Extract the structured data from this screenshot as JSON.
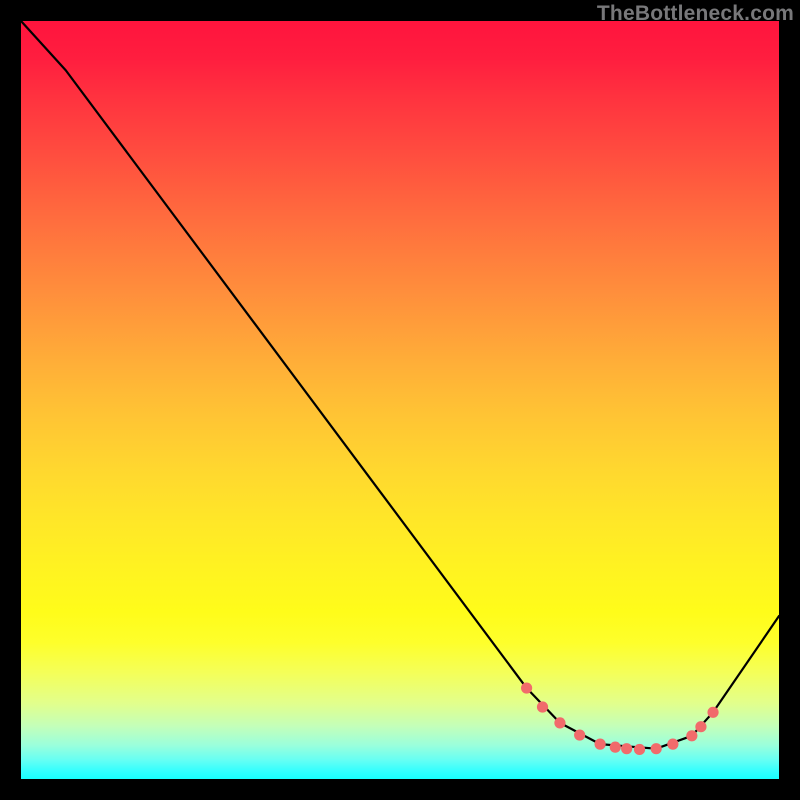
{
  "watermark": "TheBottleneck.com",
  "chart_data": {
    "type": "line",
    "title": "",
    "xlabel": "",
    "ylabel": "",
    "xlim": [
      0,
      100
    ],
    "ylim": [
      0,
      100
    ],
    "grid": false,
    "series": [
      {
        "name": "curve",
        "color": "#000000",
        "x": [
          0.0,
          5.9,
          66.7,
          71.1,
          76.4,
          83.8,
          88.5,
          91.3,
          100.0
        ],
        "values": [
          100.0,
          93.5,
          12.0,
          7.4,
          4.6,
          4.0,
          5.7,
          8.8,
          21.5
        ]
      }
    ],
    "markers": {
      "name": "dots",
      "color": "#f16b6b",
      "radius_px": 5.6,
      "x": [
        66.7,
        68.8,
        71.1,
        73.7,
        76.4,
        78.4,
        79.9,
        81.6,
        83.8,
        86.0,
        88.5,
        89.7,
        91.3
      ],
      "values": [
        12.0,
        9.5,
        7.4,
        5.8,
        4.6,
        4.2,
        4.0,
        3.9,
        4.0,
        4.6,
        5.7,
        6.9,
        8.8
      ]
    }
  }
}
